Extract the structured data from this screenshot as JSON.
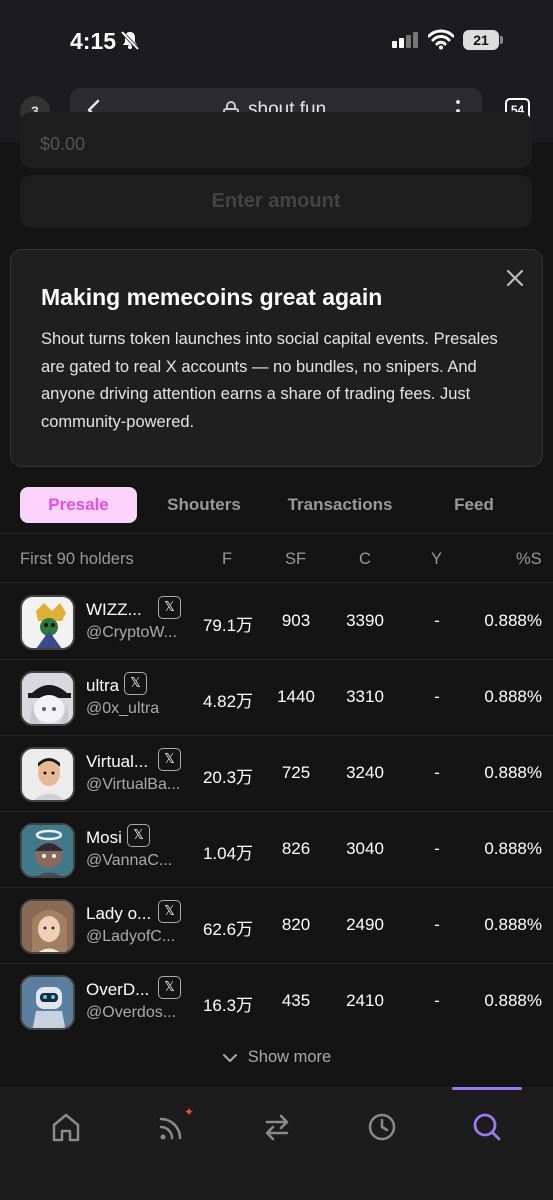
{
  "status_bar": {
    "time": "4:15",
    "battery": "21"
  },
  "browser": {
    "tab_count_left": "3",
    "url": "shout.fun",
    "tab_count_right": "54"
  },
  "form": {
    "amount_placeholder": "$0.00",
    "enter_button": "Enter amount"
  },
  "info_card": {
    "title": "Making memecoins great again",
    "body": "Shout turns token launches into social capital events. Presales are gated to real X accounts — no bundles, no snipers. And anyone driving attention earns a share of trading fees. Just community-powered."
  },
  "tabs": [
    {
      "label": "Presale",
      "active": true
    },
    {
      "label": "Shouters",
      "active": false
    },
    {
      "label": "Transactions",
      "active": false
    },
    {
      "label": "Feed",
      "active": false
    }
  ],
  "table": {
    "headers": {
      "holders": "First 90 holders",
      "f": "F",
      "sf": "SF",
      "c": "C",
      "y": "Y",
      "s": "%S"
    },
    "x_badge": "𝕏",
    "rows": [
      {
        "name": "WIZZ...",
        "handle": "@CryptoW...",
        "f": "79.1万",
        "sf": "903",
        "c": "3390",
        "y": "-",
        "s": "0.888%",
        "avatar_color": "#f2f2f2"
      },
      {
        "name": "ultra",
        "handle": "@0x_ultra",
        "f": "4.82万",
        "sf": "1440",
        "c": "3310",
        "y": "-",
        "s": "0.888%",
        "avatar_color": "#d8d8de"
      },
      {
        "name": "Virtual...",
        "handle": "@VirtualBa...",
        "f": "20.3万",
        "sf": "725",
        "c": "3240",
        "y": "-",
        "s": "0.888%",
        "avatar_color": "#ececec"
      },
      {
        "name": "Mosi",
        "handle": "@VannaC...",
        "f": "1.04万",
        "sf": "826",
        "c": "3040",
        "y": "-",
        "s": "0.888%",
        "avatar_color": "#3f7a8a"
      },
      {
        "name": "Lady o...",
        "handle": "@LadyofC...",
        "f": "62.6万",
        "sf": "820",
        "c": "2490",
        "y": "-",
        "s": "0.888%",
        "avatar_color": "#8a6a55"
      },
      {
        "name": "OverD...",
        "handle": "@Overdos...",
        "f": "16.3万",
        "sf": "435",
        "c": "2410",
        "y": "-",
        "s": "0.888%",
        "avatar_color": "#5a7fa0"
      }
    ],
    "show_more": "Show more"
  },
  "bottom_nav": [
    "home-icon",
    "rss-icon",
    "swap-icon",
    "clock-icon",
    "search-icon"
  ],
  "colors": {
    "accent": "#e64ee6",
    "accent_bg": "#fbd3fb",
    "nav_active": "#9a7af0"
  }
}
